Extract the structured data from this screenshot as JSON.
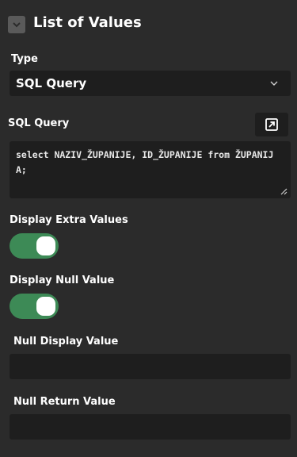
{
  "section": {
    "title": "List of Values",
    "toggle_icon": "chevron-down-icon"
  },
  "type_field": {
    "label": "Type",
    "selected": "SQL Query",
    "icon": "chevron-down-icon"
  },
  "sql_query_field": {
    "label": "SQL Query",
    "value": "select NAZIV_ŽUPANIJE, ID_ŽUPANIJE from ŽUPANIJA;",
    "expand_icon": "expand-icon"
  },
  "display_extra_values": {
    "label": "Display Extra Values",
    "enabled": true
  },
  "display_null_value": {
    "label": "Display Null Value",
    "enabled": true
  },
  "null_display_value": {
    "label": "Null Display Value",
    "value": ""
  },
  "null_return_value": {
    "label": "Null Return Value",
    "value": ""
  },
  "colors": {
    "background": "#2b2b2b",
    "field_background": "#1e1e1e",
    "toggle_on": "#3d8a56"
  }
}
